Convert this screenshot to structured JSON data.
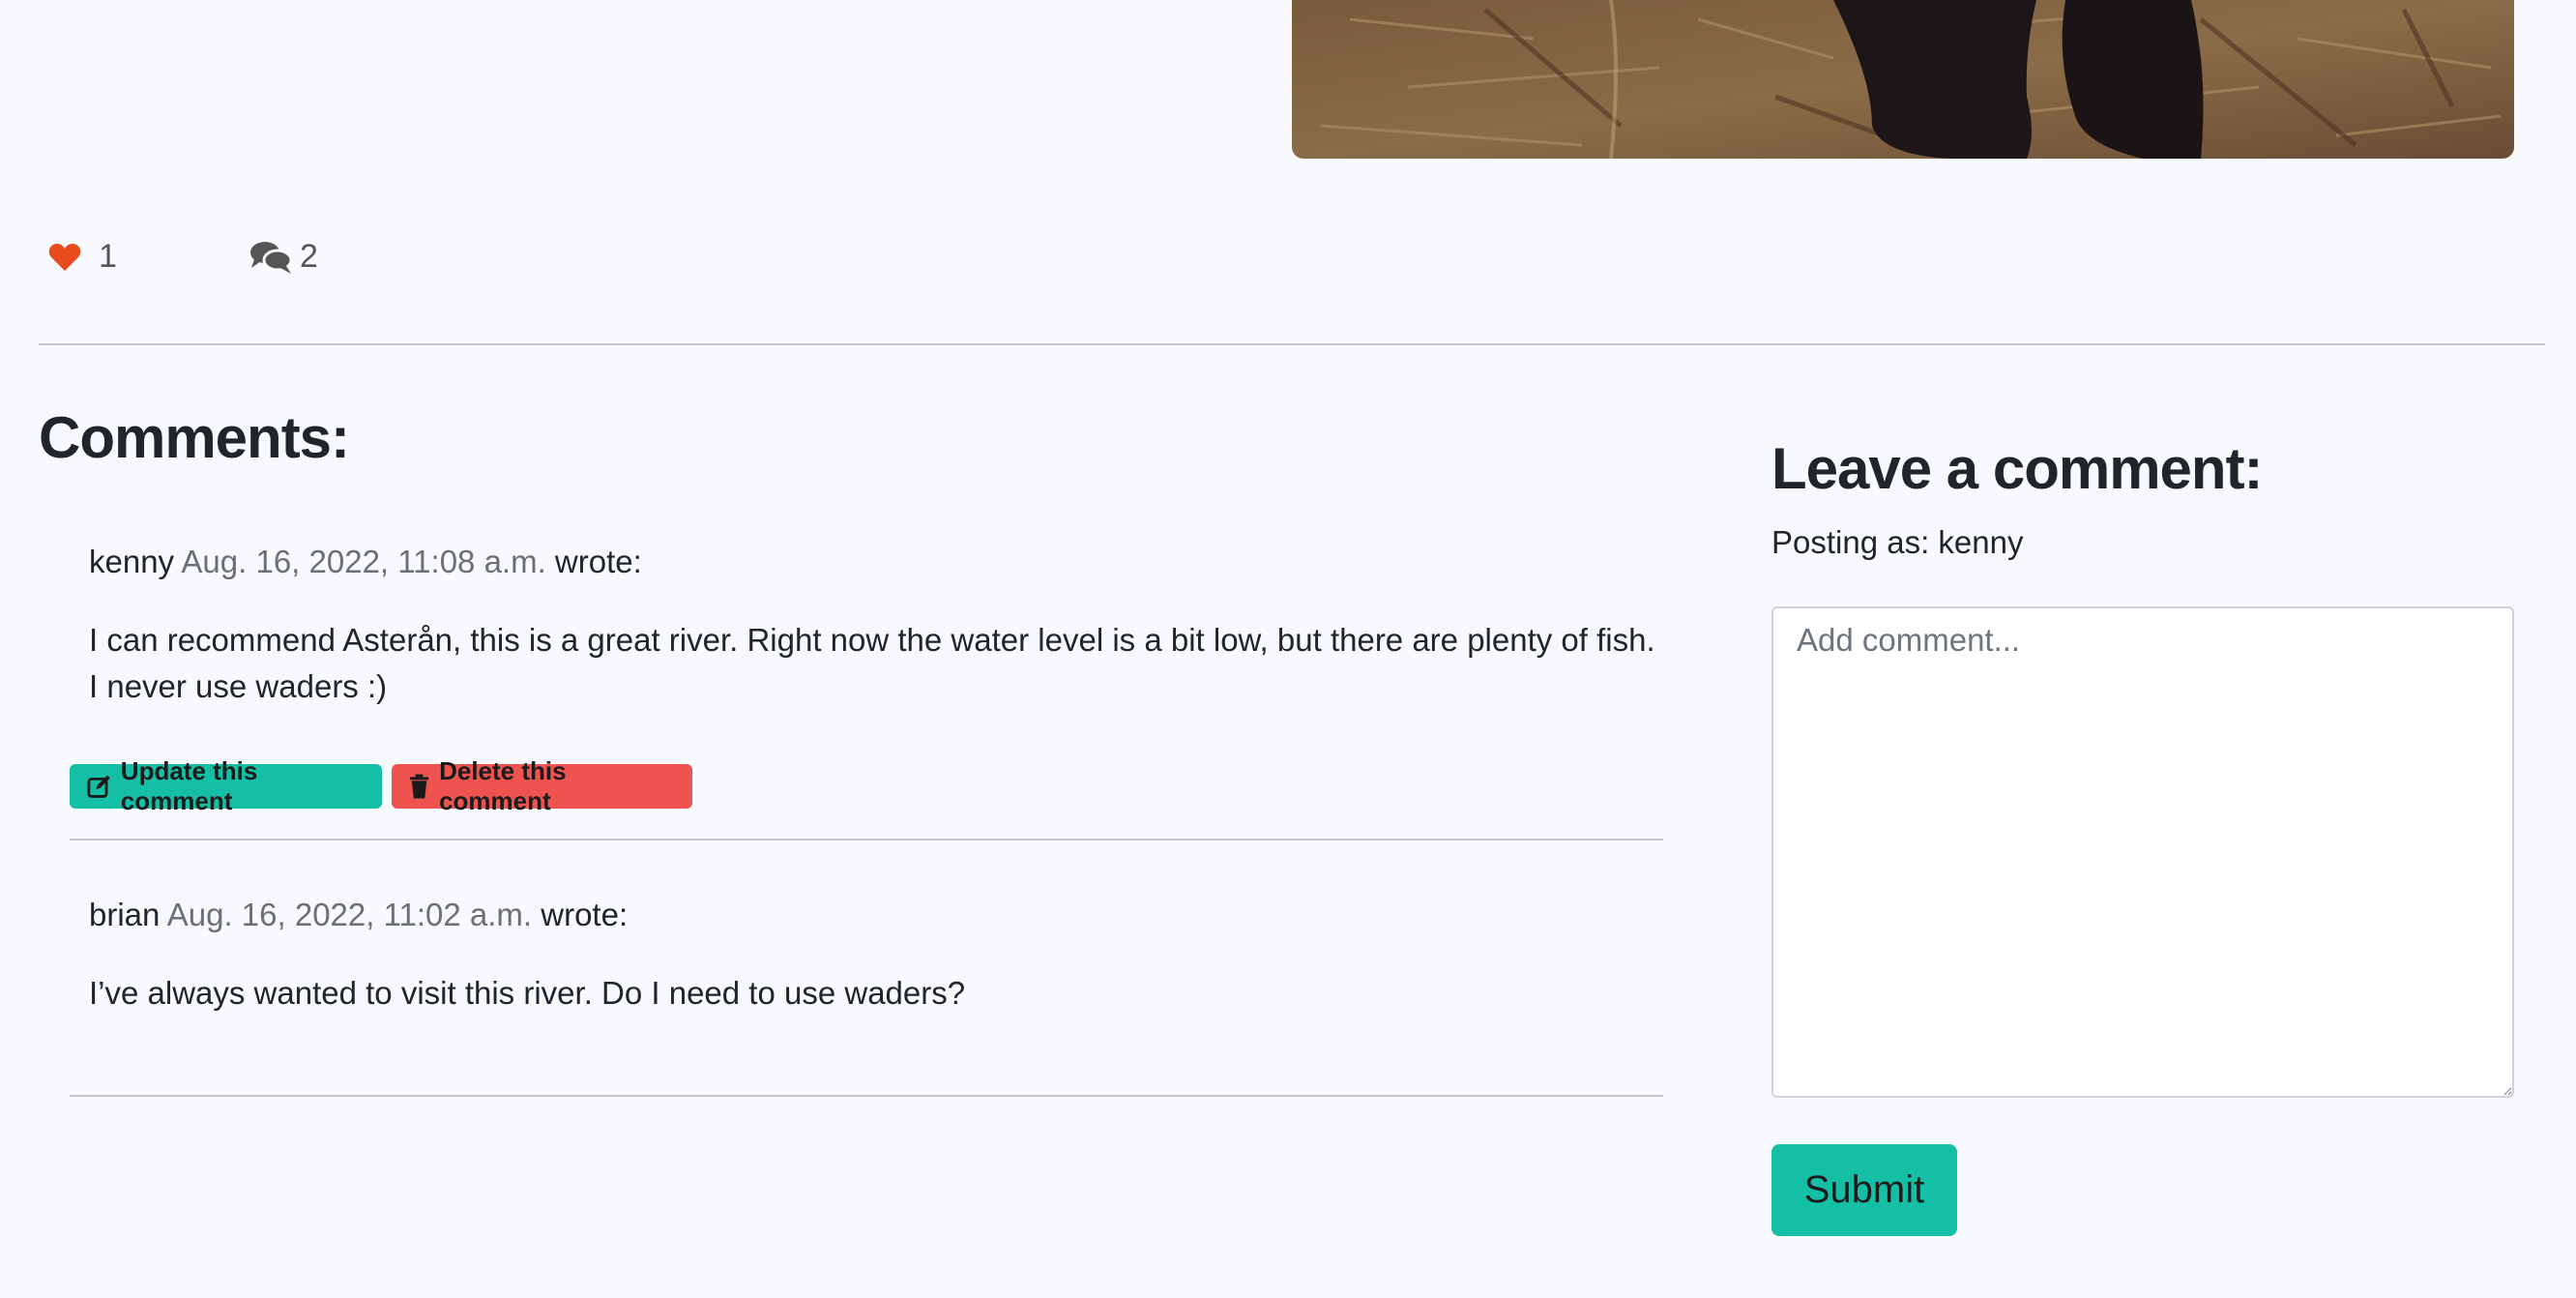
{
  "post": {
    "likes_count": "1",
    "comments_count": "2",
    "colors": {
      "heart": "#e8491d",
      "accent": "#14bfa6",
      "danger": "#ef5350"
    }
  },
  "comments_section": {
    "heading": "Comments:",
    "items": [
      {
        "author": "kenny",
        "date": "Aug. 16, 2022, 11:08 a.m.",
        "wrote": "wrote:",
        "body_line1": "I can recommend Asterån, this is a great river. Right now the water level is a bit low, but there are plenty of fish.",
        "body_line2": "I never use waders :)",
        "update_label": "Update this comment",
        "delete_label": "Delete this comment"
      },
      {
        "author": "brian",
        "date": "Aug. 16, 2022, 11:02 a.m.",
        "wrote": "wrote:",
        "body_line1": "I’ve always wanted to visit this river. Do I need to use waders?"
      }
    ]
  },
  "comment_form": {
    "heading": "Leave a comment:",
    "posting_as": "Posting as: kenny",
    "placeholder": "Add comment...",
    "submit_label": "Submit"
  }
}
